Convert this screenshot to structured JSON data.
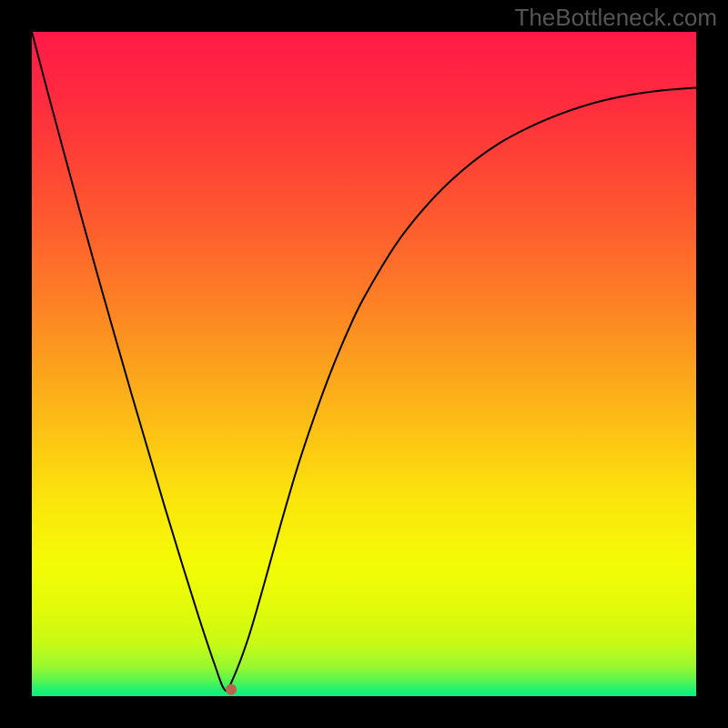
{
  "watermark": "TheBottleneck.com",
  "colors": {
    "background": "#000000",
    "curve": "#000000",
    "marker": "#bb644d"
  },
  "gradient_stops": [
    {
      "offset": 0.0,
      "color": "#ff1a47"
    },
    {
      "offset": 0.1,
      "color": "#ff2b3f"
    },
    {
      "offset": 0.2,
      "color": "#ff4435"
    },
    {
      "offset": 0.3,
      "color": "#fe5f2d"
    },
    {
      "offset": 0.4,
      "color": "#fd7e25"
    },
    {
      "offset": 0.5,
      "color": "#fca01d"
    },
    {
      "offset": 0.6,
      "color": "#fcc114"
    },
    {
      "offset": 0.7,
      "color": "#fbe40c"
    },
    {
      "offset": 0.8,
      "color": "#f4fb06"
    },
    {
      "offset": 0.87,
      "color": "#e1fb0a"
    },
    {
      "offset": 0.92,
      "color": "#c8fa15"
    },
    {
      "offset": 0.955,
      "color": "#99f82e"
    },
    {
      "offset": 0.975,
      "color": "#5ef54f"
    },
    {
      "offset": 0.99,
      "color": "#22f171"
    },
    {
      "offset": 1.0,
      "color": "#08f081"
    }
  ],
  "chart_data": {
    "type": "line",
    "title": "",
    "xlabel": "",
    "ylabel": "",
    "xlim": [
      0,
      1
    ],
    "ylim": [
      0,
      1
    ],
    "optimum_x": 0.29,
    "marker": {
      "x": 0.3,
      "y": 0.01
    },
    "series": [
      {
        "name": "bottleneck-curve",
        "x": [
          0.0,
          0.025,
          0.05,
          0.075,
          0.1,
          0.125,
          0.15,
          0.175,
          0.2,
          0.225,
          0.25,
          0.275,
          0.29,
          0.3,
          0.325,
          0.35,
          0.375,
          0.4,
          0.425,
          0.45,
          0.475,
          0.5,
          0.55,
          0.6,
          0.65,
          0.7,
          0.75,
          0.8,
          0.85,
          0.9,
          0.95,
          1.0
        ],
        "y": [
          1.0,
          0.905,
          0.812,
          0.72,
          0.63,
          0.542,
          0.455,
          0.37,
          0.285,
          0.203,
          0.123,
          0.048,
          0.01,
          0.02,
          0.085,
          0.17,
          0.26,
          0.345,
          0.42,
          0.488,
          0.548,
          0.6,
          0.683,
          0.745,
          0.793,
          0.83,
          0.857,
          0.878,
          0.894,
          0.905,
          0.912,
          0.916
        ]
      }
    ]
  }
}
